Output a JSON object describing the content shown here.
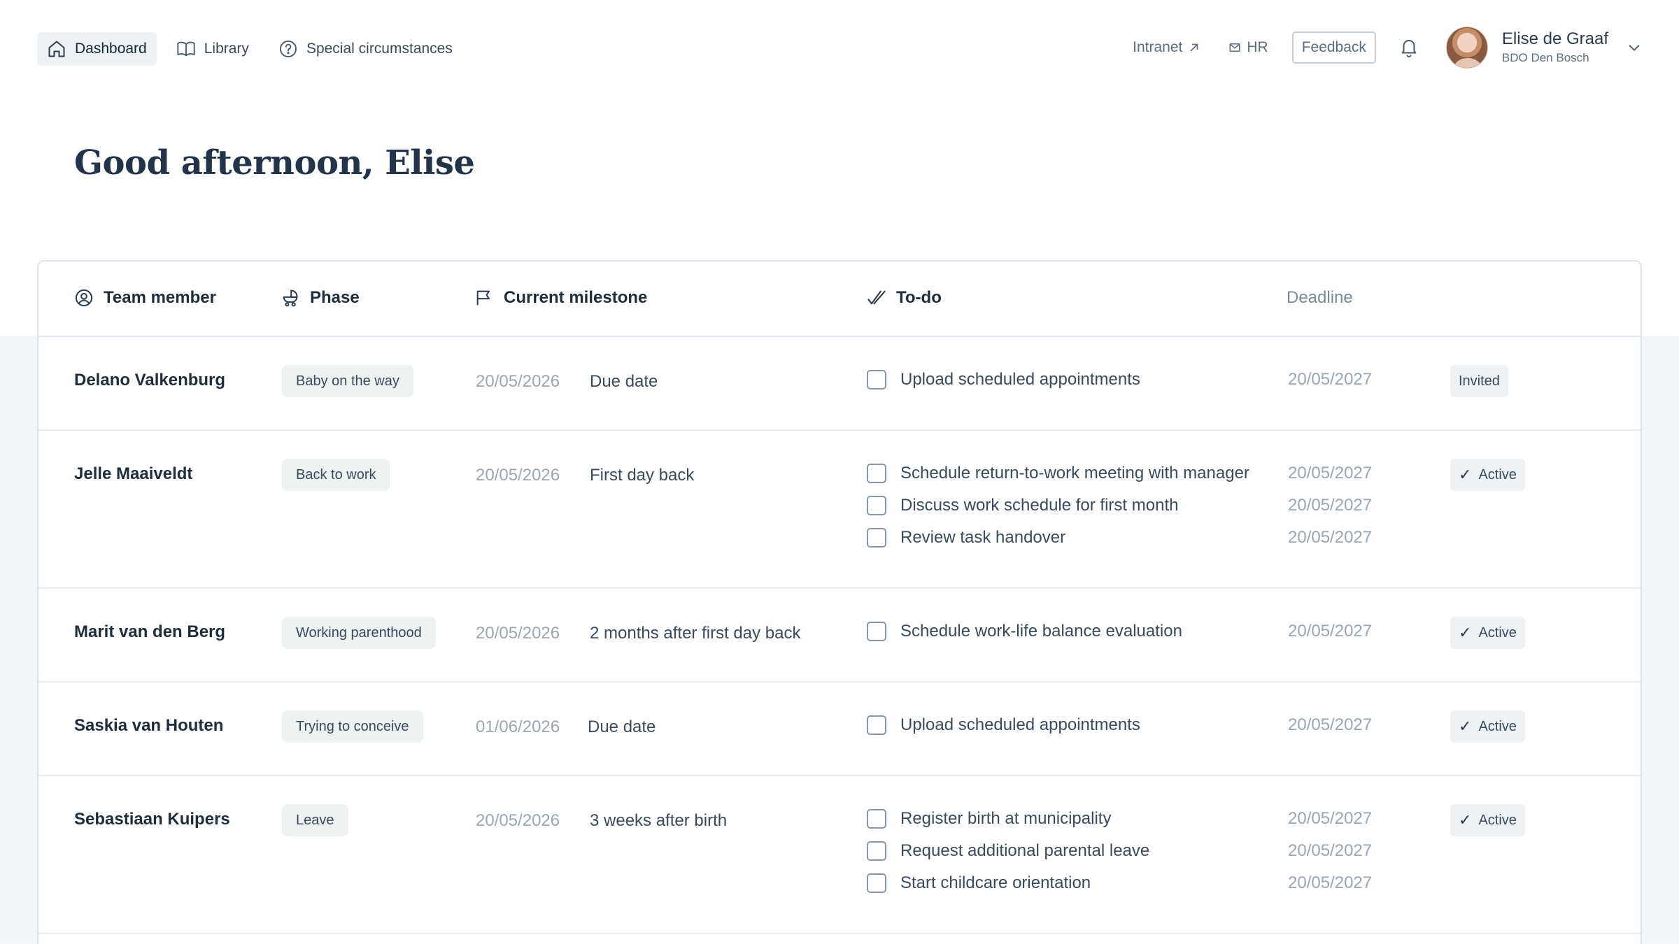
{
  "nav": {
    "items": [
      {
        "label": "Dashboard",
        "icon": "home-icon",
        "active": true
      },
      {
        "label": "Library",
        "icon": "book-icon",
        "active": false
      },
      {
        "label": "Special circumstances",
        "icon": "question-circle-icon",
        "active": false
      }
    ],
    "intranet_label": "Intranet",
    "hr_label": "HR",
    "feedback_label": "Feedback",
    "user": {
      "name": "Elise de Graaf",
      "org": "BDO Den Bosch"
    }
  },
  "greeting": "Good afternoon, Elise",
  "table": {
    "headers": {
      "member": "Team member",
      "phase": "Phase",
      "milestone": "Current milestone",
      "todo": "To-do",
      "deadline": "Deadline"
    },
    "rows": [
      {
        "member": "Delano Valkenburg",
        "phase": "Baby on the way",
        "milestone_date": "20/05/2026",
        "milestone": "Due date",
        "todos": [
          {
            "label": "Upload scheduled appointments",
            "deadline": "20/05/2027"
          }
        ],
        "status": "Invited",
        "status_check": false
      },
      {
        "member": "Jelle Maaiveldt",
        "phase": "Back to work",
        "milestone_date": "20/05/2026",
        "milestone": "First day back",
        "todos": [
          {
            "label": "Schedule return-to-work meeting with manager",
            "deadline": "20/05/2027"
          },
          {
            "label": "Discuss work schedule for first month",
            "deadline": "20/05/2027"
          },
          {
            "label": "Review task handover",
            "deadline": "20/05/2027"
          }
        ],
        "status": "Active",
        "status_check": true
      },
      {
        "member": "Marit van den Berg",
        "phase": "Working parenthood",
        "milestone_date": "20/05/2026",
        "milestone": "2 months after first day back",
        "todos": [
          {
            "label": "Schedule work-life balance evaluation",
            "deadline": "20/05/2027"
          }
        ],
        "status": "Active",
        "status_check": true
      },
      {
        "member": "Saskia van Houten",
        "phase": "Trying to conceive",
        "milestone_date": "01/06/2026",
        "milestone": "Due date",
        "todos": [
          {
            "label": "Upload scheduled appointments",
            "deadline": "20/05/2027"
          }
        ],
        "status": "Active",
        "status_check": true
      },
      {
        "member": "Sebastiaan Kuipers",
        "phase": "Leave",
        "milestone_date": "20/05/2026",
        "milestone": "3 weeks after birth",
        "todos": [
          {
            "label": "Register birth at municipality",
            "deadline": "20/05/2027"
          },
          {
            "label": "Request additional parental leave",
            "deadline": "20/05/2027"
          },
          {
            "label": "Start childcare orientation",
            "deadline": "20/05/2027"
          }
        ],
        "status": "Active",
        "status_check": true
      }
    ]
  },
  "colors": {
    "accent": "#22334a",
    "muted": "#9aa6b2",
    "chip": "#eef2f1",
    "border": "#dde3e8"
  }
}
